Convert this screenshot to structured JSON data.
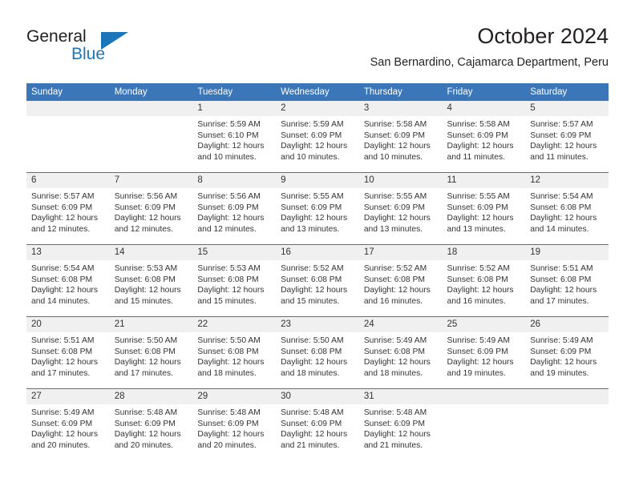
{
  "logo": {
    "line1": "General",
    "line2": "Blue",
    "icon": "triangle-logo-icon"
  },
  "header": {
    "title": "October 2024",
    "subtitle": "San Bernardino, Cajamarca Department, Peru"
  },
  "colors": {
    "header_blue": "#3a76b8",
    "logo_blue": "#1b75bb",
    "daynum_band": "#f0f0f0",
    "text": "#333333"
  },
  "weekdays": [
    "Sunday",
    "Monday",
    "Tuesday",
    "Wednesday",
    "Thursday",
    "Friday",
    "Saturday"
  ],
  "weeks": [
    [
      {
        "day": "",
        "blank": true
      },
      {
        "day": "",
        "blank": true
      },
      {
        "day": "1",
        "sunrise": "Sunrise: 5:59 AM",
        "sunset": "Sunset: 6:10 PM",
        "daylight": "Daylight: 12 hours and 10 minutes."
      },
      {
        "day": "2",
        "sunrise": "Sunrise: 5:59 AM",
        "sunset": "Sunset: 6:09 PM",
        "daylight": "Daylight: 12 hours and 10 minutes."
      },
      {
        "day": "3",
        "sunrise": "Sunrise: 5:58 AM",
        "sunset": "Sunset: 6:09 PM",
        "daylight": "Daylight: 12 hours and 10 minutes."
      },
      {
        "day": "4",
        "sunrise": "Sunrise: 5:58 AM",
        "sunset": "Sunset: 6:09 PM",
        "daylight": "Daylight: 12 hours and 11 minutes."
      },
      {
        "day": "5",
        "sunrise": "Sunrise: 5:57 AM",
        "sunset": "Sunset: 6:09 PM",
        "daylight": "Daylight: 12 hours and 11 minutes."
      }
    ],
    [
      {
        "day": "6",
        "sunrise": "Sunrise: 5:57 AM",
        "sunset": "Sunset: 6:09 PM",
        "daylight": "Daylight: 12 hours and 12 minutes."
      },
      {
        "day": "7",
        "sunrise": "Sunrise: 5:56 AM",
        "sunset": "Sunset: 6:09 PM",
        "daylight": "Daylight: 12 hours and 12 minutes."
      },
      {
        "day": "8",
        "sunrise": "Sunrise: 5:56 AM",
        "sunset": "Sunset: 6:09 PM",
        "daylight": "Daylight: 12 hours and 12 minutes."
      },
      {
        "day": "9",
        "sunrise": "Sunrise: 5:55 AM",
        "sunset": "Sunset: 6:09 PM",
        "daylight": "Daylight: 12 hours and 13 minutes."
      },
      {
        "day": "10",
        "sunrise": "Sunrise: 5:55 AM",
        "sunset": "Sunset: 6:09 PM",
        "daylight": "Daylight: 12 hours and 13 minutes."
      },
      {
        "day": "11",
        "sunrise": "Sunrise: 5:55 AM",
        "sunset": "Sunset: 6:09 PM",
        "daylight": "Daylight: 12 hours and 13 minutes."
      },
      {
        "day": "12",
        "sunrise": "Sunrise: 5:54 AM",
        "sunset": "Sunset: 6:08 PM",
        "daylight": "Daylight: 12 hours and 14 minutes."
      }
    ],
    [
      {
        "day": "13",
        "sunrise": "Sunrise: 5:54 AM",
        "sunset": "Sunset: 6:08 PM",
        "daylight": "Daylight: 12 hours and 14 minutes."
      },
      {
        "day": "14",
        "sunrise": "Sunrise: 5:53 AM",
        "sunset": "Sunset: 6:08 PM",
        "daylight": "Daylight: 12 hours and 15 minutes."
      },
      {
        "day": "15",
        "sunrise": "Sunrise: 5:53 AM",
        "sunset": "Sunset: 6:08 PM",
        "daylight": "Daylight: 12 hours and 15 minutes."
      },
      {
        "day": "16",
        "sunrise": "Sunrise: 5:52 AM",
        "sunset": "Sunset: 6:08 PM",
        "daylight": "Daylight: 12 hours and 15 minutes."
      },
      {
        "day": "17",
        "sunrise": "Sunrise: 5:52 AM",
        "sunset": "Sunset: 6:08 PM",
        "daylight": "Daylight: 12 hours and 16 minutes."
      },
      {
        "day": "18",
        "sunrise": "Sunrise: 5:52 AM",
        "sunset": "Sunset: 6:08 PM",
        "daylight": "Daylight: 12 hours and 16 minutes."
      },
      {
        "day": "19",
        "sunrise": "Sunrise: 5:51 AM",
        "sunset": "Sunset: 6:08 PM",
        "daylight": "Daylight: 12 hours and 17 minutes."
      }
    ],
    [
      {
        "day": "20",
        "sunrise": "Sunrise: 5:51 AM",
        "sunset": "Sunset: 6:08 PM",
        "daylight": "Daylight: 12 hours and 17 minutes."
      },
      {
        "day": "21",
        "sunrise": "Sunrise: 5:50 AM",
        "sunset": "Sunset: 6:08 PM",
        "daylight": "Daylight: 12 hours and 17 minutes."
      },
      {
        "day": "22",
        "sunrise": "Sunrise: 5:50 AM",
        "sunset": "Sunset: 6:08 PM",
        "daylight": "Daylight: 12 hours and 18 minutes."
      },
      {
        "day": "23",
        "sunrise": "Sunrise: 5:50 AM",
        "sunset": "Sunset: 6:08 PM",
        "daylight": "Daylight: 12 hours and 18 minutes."
      },
      {
        "day": "24",
        "sunrise": "Sunrise: 5:49 AM",
        "sunset": "Sunset: 6:08 PM",
        "daylight": "Daylight: 12 hours and 18 minutes."
      },
      {
        "day": "25",
        "sunrise": "Sunrise: 5:49 AM",
        "sunset": "Sunset: 6:09 PM",
        "daylight": "Daylight: 12 hours and 19 minutes."
      },
      {
        "day": "26",
        "sunrise": "Sunrise: 5:49 AM",
        "sunset": "Sunset: 6:09 PM",
        "daylight": "Daylight: 12 hours and 19 minutes."
      }
    ],
    [
      {
        "day": "27",
        "sunrise": "Sunrise: 5:49 AM",
        "sunset": "Sunset: 6:09 PM",
        "daylight": "Daylight: 12 hours and 20 minutes."
      },
      {
        "day": "28",
        "sunrise": "Sunrise: 5:48 AM",
        "sunset": "Sunset: 6:09 PM",
        "daylight": "Daylight: 12 hours and 20 minutes."
      },
      {
        "day": "29",
        "sunrise": "Sunrise: 5:48 AM",
        "sunset": "Sunset: 6:09 PM",
        "daylight": "Daylight: 12 hours and 20 minutes."
      },
      {
        "day": "30",
        "sunrise": "Sunrise: 5:48 AM",
        "sunset": "Sunset: 6:09 PM",
        "daylight": "Daylight: 12 hours and 21 minutes."
      },
      {
        "day": "31",
        "sunrise": "Sunrise: 5:48 AM",
        "sunset": "Sunset: 6:09 PM",
        "daylight": "Daylight: 12 hours and 21 minutes."
      },
      {
        "day": "",
        "blank": true
      },
      {
        "day": "",
        "blank": true
      }
    ]
  ]
}
